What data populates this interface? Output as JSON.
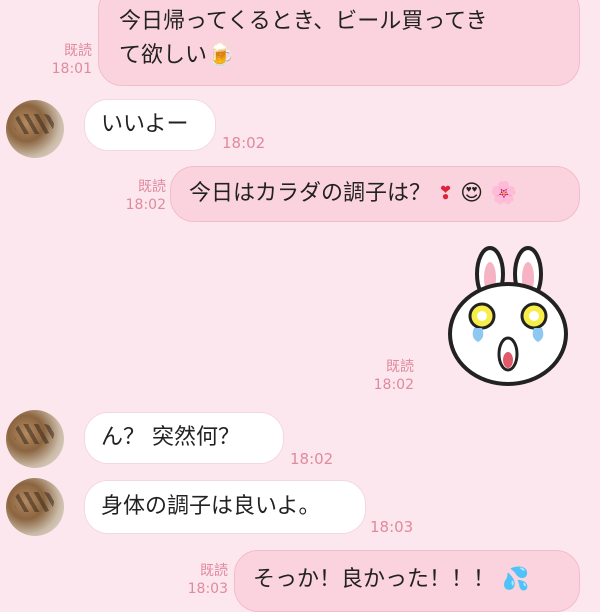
{
  "messages": [
    {
      "id": "m1",
      "side": "out",
      "lines": [
        "今日帰ってくるとき、ビール買ってき",
        "て欲しい"
      ],
      "emoji": "🍺",
      "read": "既読",
      "time": "18:01"
    },
    {
      "id": "m2",
      "side": "in",
      "text": "いいよー",
      "time": "18:02"
    },
    {
      "id": "m3",
      "side": "out",
      "text": "今日はカラダの調子は？",
      "emojis": [
        "❣",
        "😍",
        "🌸"
      ],
      "read": "既読",
      "time": "18:02"
    },
    {
      "id": "m4",
      "side": "out",
      "type": "sticker",
      "sticker": "cony-bunny-sticker",
      "read": "既読",
      "time": "18:02"
    },
    {
      "id": "m5",
      "side": "in",
      "text": "ん？ 突然何？",
      "time": "18:02"
    },
    {
      "id": "m6",
      "side": "in",
      "text": "身体の調子は良いよ。",
      "time": "18:03"
    },
    {
      "id": "m7",
      "side": "out",
      "text": "そっか！良かった！！！",
      "emoji": "💦",
      "read": "既読",
      "time": "18:03"
    }
  ],
  "colors": {
    "background": "#fde7ee",
    "outgoing": "#fbd3df",
    "incoming": "#ffffff",
    "meta": "#e0899f"
  }
}
